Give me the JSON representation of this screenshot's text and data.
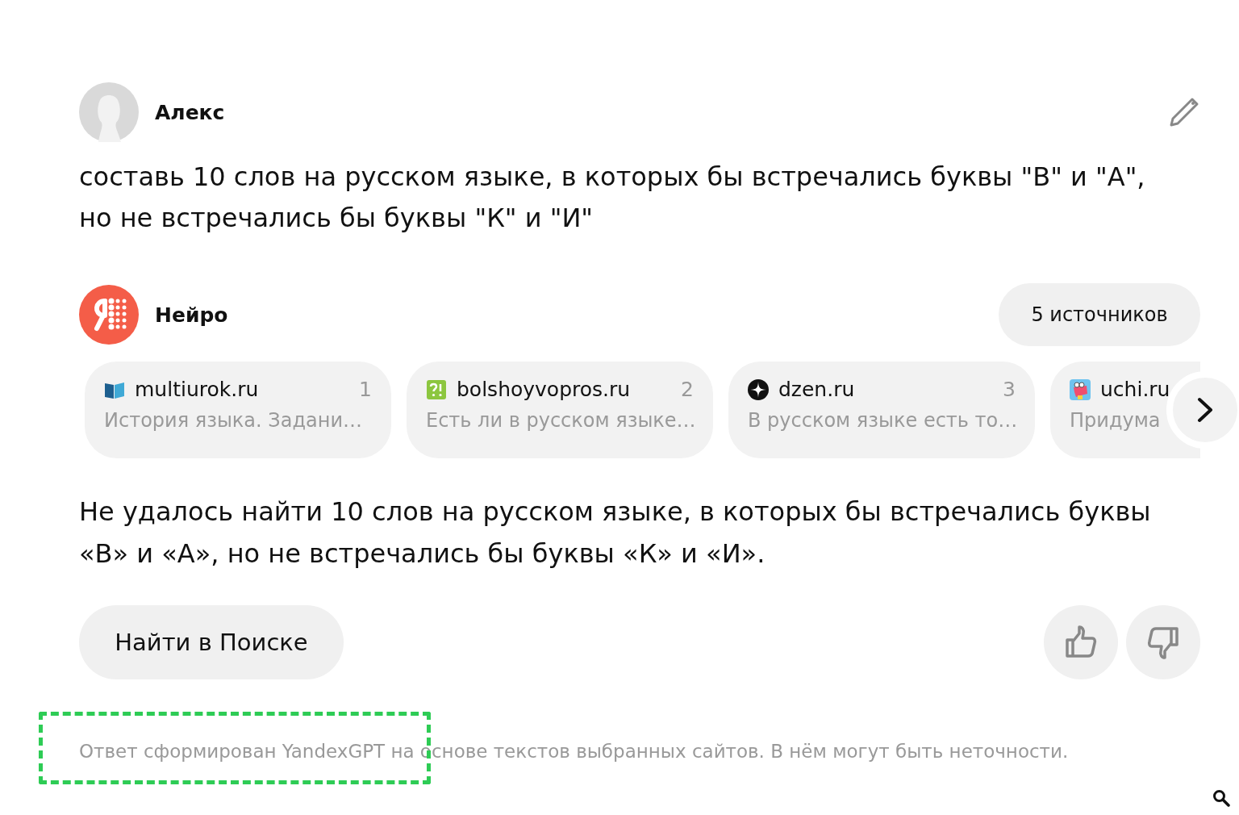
{
  "user": {
    "name": "Алекс"
  },
  "question": "составь 10 слов на русском языке, в которых бы встречались буквы \"В\" и \"А\", но не встречались бы буквы \"К\" и \"И\"",
  "assistant": {
    "name": "Нейро",
    "sources_button": "5 источников"
  },
  "sources": [
    {
      "site": "multiurok.ru",
      "number": "1",
      "snippet": "История языка. Задани…",
      "kind": "book"
    },
    {
      "site": "bolshoyvopros.ru",
      "number": "2",
      "snippet": "Есть ли в русском языке…",
      "kind": "question"
    },
    {
      "site": "dzen.ru",
      "number": "3",
      "snippet": "В русском языке есть то…",
      "kind": "star"
    },
    {
      "site": "uchi.ru",
      "snippet": "Придума",
      "kind": "dino"
    }
  ],
  "answer": "Не удалось найти 10 слов на русском языке, в которых бы встречались буквы «В» и «А», но не встречались бы буквы «К» и «И».",
  "search_button": "Найти в Поиске",
  "disclaimer": "Ответ сформирован YandexGPT на основе текстов выбранных сайтов. В нём могут быть неточности."
}
